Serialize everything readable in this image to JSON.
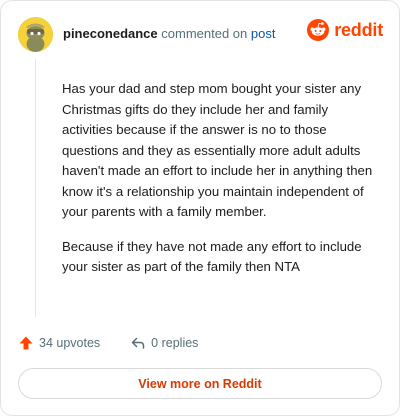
{
  "comment": {
    "username": "pineconedance",
    "action_text": "commented on",
    "post_link": "post",
    "paragraphs": [
      "Has your dad and step mom bought your sister any Christmas gifts do they include her and family activities because if the answer is no to those questions and they as essentially more adult adults haven't made an effort to include her in anything then know it's a relationship you maintain independent of your parents with a family member.",
      "Because if they have not made any effort to include your sister as part of the family then NTA"
    ]
  },
  "brand": {
    "name": "reddit",
    "icon": "reddit-logo-icon"
  },
  "stats": {
    "upvotes": "34 upvotes",
    "replies": "0 replies",
    "upvote_icon": "upvote-arrow-icon",
    "reply_icon": "reply-arrow-icon"
  },
  "footer": {
    "view_more_label": "View more on Reddit"
  },
  "colors": {
    "reddit_orange": "#ff4500",
    "link_blue": "#0a58a5",
    "muted_text": "#576f76",
    "button_text": "#d93a00"
  }
}
